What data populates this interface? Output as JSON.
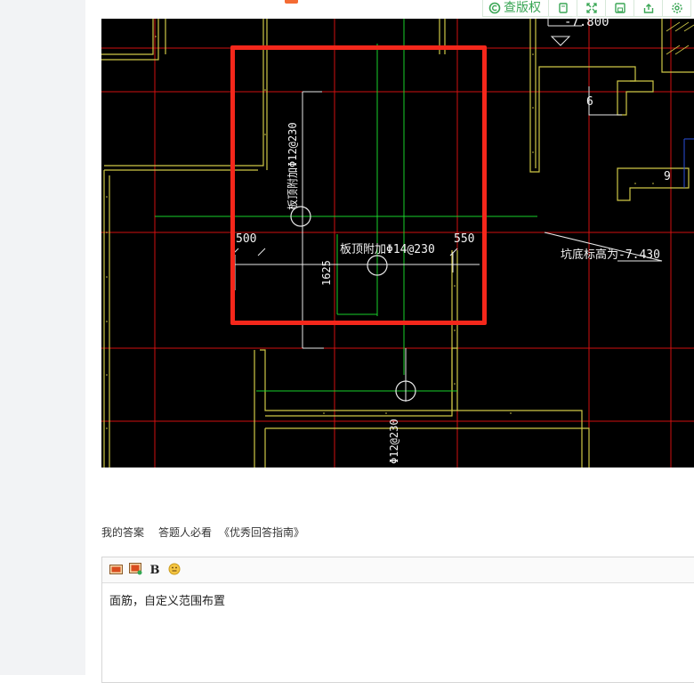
{
  "toolbar": {
    "review_label": "查版权",
    "icons": [
      "search-copyright-icon",
      "copy-icon",
      "fullscreen-icon",
      "save-icon",
      "share-icon",
      "settings-icon"
    ]
  },
  "cad": {
    "labels": {
      "elevation_top": "-7.800",
      "rebar_vertical_top": "板顶附加Φ12@230",
      "rebar_horizontal": "板顶附加Φ14@230",
      "dim_500": "500",
      "dim_550": "550",
      "dim_1625": "1625",
      "mark_6": "6",
      "mark_9": "9",
      "pit_elevation": "坑底标高为-7.430",
      "rebar_vertical_bottom": "Φ12@230"
    },
    "colors": {
      "background": "#000000",
      "highlight": "#f4271b",
      "rebar": "#19d12a",
      "axis": "#e01010",
      "wall": "#d8d24a"
    }
  },
  "answer": {
    "my_answer": "我的答案",
    "must_read": "答题人必看",
    "guide": "《优秀回答指南》"
  },
  "editor": {
    "icons": [
      "insert-image-icon",
      "upload-image-icon",
      "bold-icon",
      "emoji-icon"
    ],
    "bold_label": "B",
    "content": "面筋，自定义范围布置"
  }
}
